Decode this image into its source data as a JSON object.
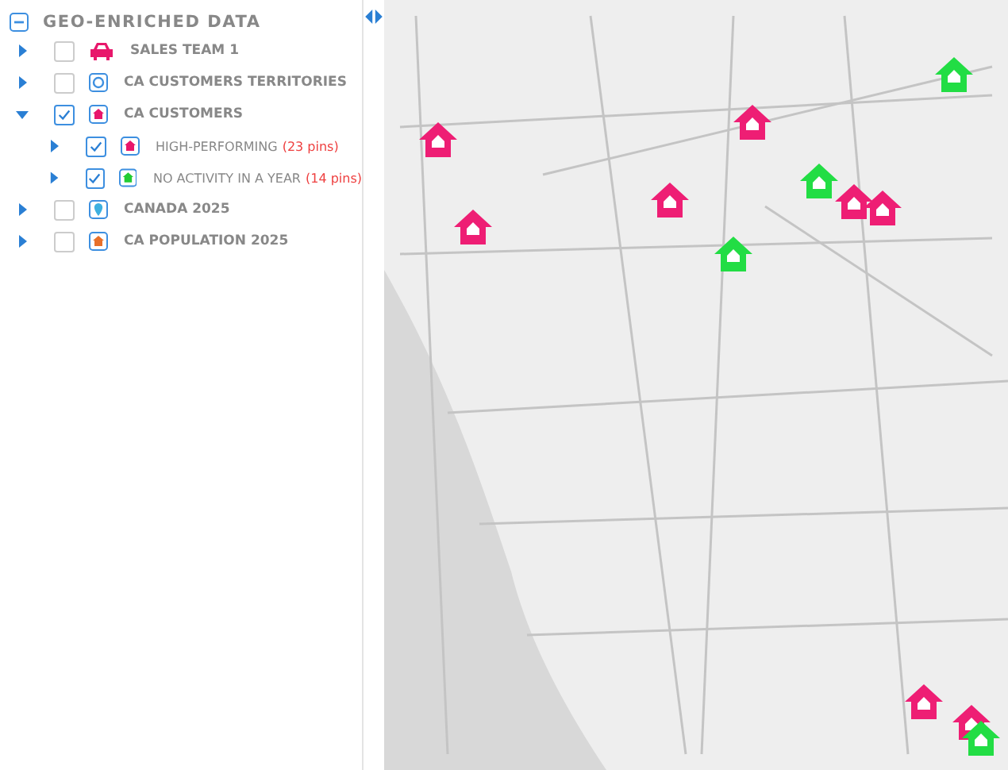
{
  "panel": {
    "title": "GEO-ENRICHED DATA",
    "expanded": true
  },
  "layers": [
    {
      "label": "SALES TEAM 1",
      "kind": "car",
      "color": "#e8176b",
      "checked": false,
      "expanded": false
    },
    {
      "label": "CA CUSTOMERS TERRITORIES",
      "kind": "circle",
      "color": "#3d8fe0",
      "checked": false,
      "expanded": false
    },
    {
      "label": "CA CUSTOMERS",
      "kind": "house",
      "color": "#e8176b",
      "checked": true,
      "expanded": true,
      "children": [
        {
          "label": "HIGH-PERFORMING",
          "count": "(23 pins)",
          "kind": "house",
          "color": "#e8176b",
          "checked": true,
          "expanded": false
        },
        {
          "label": "NO ACTIVITY IN A YEAR",
          "count": "(14 pins)",
          "kind": "house",
          "color": "#22cc33",
          "checked": true,
          "expanded": false
        }
      ]
    },
    {
      "label": "CANADA 2025",
      "kind": "pin",
      "color": "#3db0e0",
      "checked": false,
      "expanded": false
    },
    {
      "label": "CA POPULATION 2025",
      "kind": "house",
      "color": "#e8702a",
      "checked": false,
      "expanded": false
    }
  ],
  "map_pins": [
    {
      "color": "#ee1e74"
    },
    {
      "color": "#ee1e74"
    },
    {
      "color": "#ee1e74"
    },
    {
      "color": "#ee1e74"
    },
    {
      "color": "#ee1e74"
    },
    {
      "color": "#ee1e74"
    },
    {
      "color": "#ee1e74"
    },
    {
      "color": "#ee1e74"
    },
    {
      "color": "#22dd44"
    },
    {
      "color": "#22dd44"
    },
    {
      "color": "#22dd44"
    },
    {
      "color": "#22dd44"
    }
  ]
}
